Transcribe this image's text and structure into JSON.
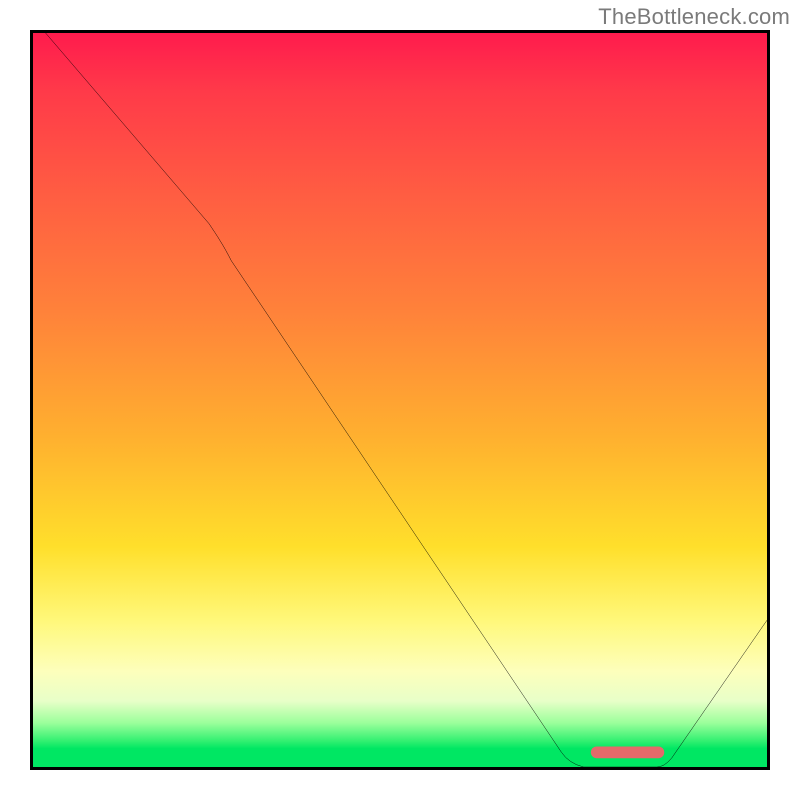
{
  "attribution": "TheBottleneck.com",
  "chart_data": {
    "type": "line",
    "title": "",
    "xlabel": "",
    "ylabel": "",
    "xlim": [
      0,
      100
    ],
    "ylim": [
      0,
      100
    ],
    "grid": false,
    "legend": false,
    "series": [
      {
        "name": "curve",
        "color": "#000000",
        "x": [
          0,
          24,
          72,
          78,
          85,
          100
        ],
        "y": [
          102,
          74,
          2,
          0,
          0,
          20
        ]
      }
    ],
    "markers": [
      {
        "name": "optimal-range",
        "shape": "rounded-bar",
        "color": "#e46a6a",
        "x_start": 76,
        "x_end": 86,
        "y": 1.2,
        "thickness": 1.6
      }
    ],
    "background_bands_note": "Vertical color gradient from red (bottleneck) at top to green (optimal) at bottom; not discrete bands."
  }
}
